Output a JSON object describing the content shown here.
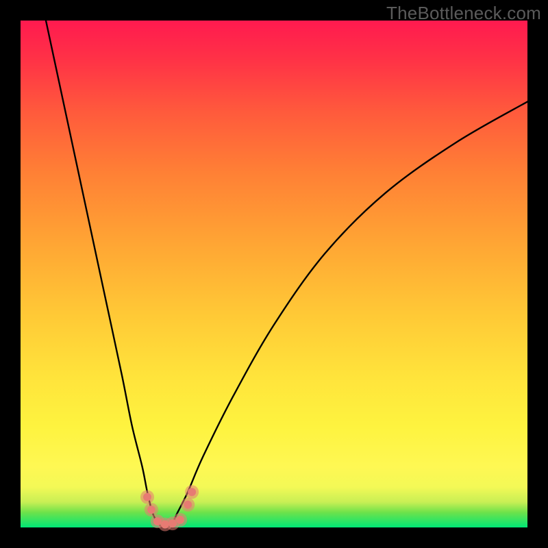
{
  "watermark": "TheBottleneck.com",
  "chart_data": {
    "type": "line",
    "title": "",
    "xlabel": "",
    "ylabel": "",
    "xlim": [
      0,
      100
    ],
    "ylim": [
      0,
      100
    ],
    "grid": false,
    "series": [
      {
        "name": "bottleneck-curve",
        "x": [
          5,
          8,
          11,
          14,
          17,
          20,
          22,
          24,
          25,
          26,
          27,
          28,
          29,
          30,
          31,
          33,
          36,
          42,
          50,
          60,
          72,
          86,
          100
        ],
        "y": [
          100,
          86,
          72,
          58,
          44,
          30,
          20,
          12,
          7,
          3,
          1,
          0,
          0,
          1,
          3,
          7,
          14,
          26,
          40,
          54,
          66,
          76,
          84
        ]
      }
    ],
    "markers": [
      {
        "name": "marker-left-upper",
        "x": 25.0,
        "y": 6.0
      },
      {
        "name": "marker-left-lower",
        "x": 25.8,
        "y": 3.5
      },
      {
        "name": "marker-bottom-1",
        "x": 27.0,
        "y": 1.2
      },
      {
        "name": "marker-bottom-2",
        "x": 28.5,
        "y": 0.6
      },
      {
        "name": "marker-bottom-3",
        "x": 30.0,
        "y": 0.8
      },
      {
        "name": "marker-bottom-4",
        "x": 31.5,
        "y": 1.5
      },
      {
        "name": "marker-right-lower",
        "x": 33.0,
        "y": 4.5
      },
      {
        "name": "marker-right-upper",
        "x": 33.8,
        "y": 7.0
      }
    ],
    "marker_color": "#e77b73",
    "curve_color": "#000000"
  }
}
